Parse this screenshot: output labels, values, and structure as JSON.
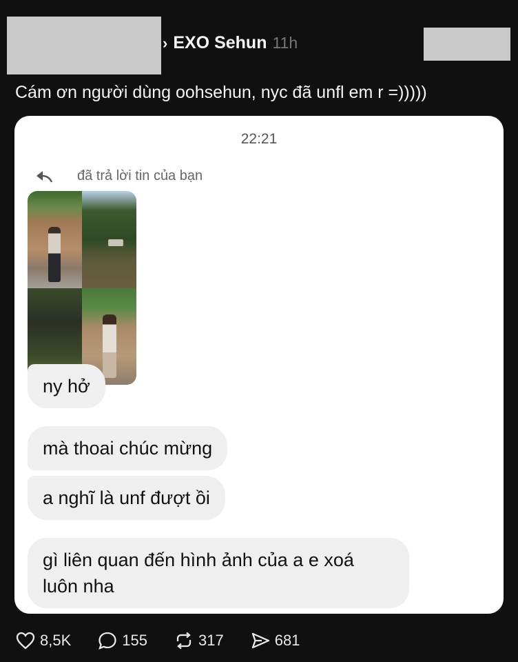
{
  "header": {
    "author": "EXO Sehun",
    "time": "11h",
    "separator": "›"
  },
  "post": {
    "text": "Cám ơn người dùng oohsehun, nyc đã unfl em r =)))))"
  },
  "screenshot": {
    "timestamp": "22:21",
    "reply_label": "đã trả lời tin của bạn",
    "messages": [
      "ny hở",
      "mà thoai chúc mừng",
      "a nghĩ là unf đượt ồi",
      "gì liên quan đến hình ảnh của a e xoá luôn nha"
    ]
  },
  "actions": {
    "likes": "8,5K",
    "comments": "155",
    "reposts": "317",
    "shares": "681"
  },
  "colors": {
    "background": "#101010",
    "card": "#ffffff",
    "bubble": "#efefef",
    "redaction": "#c9c9c9"
  }
}
